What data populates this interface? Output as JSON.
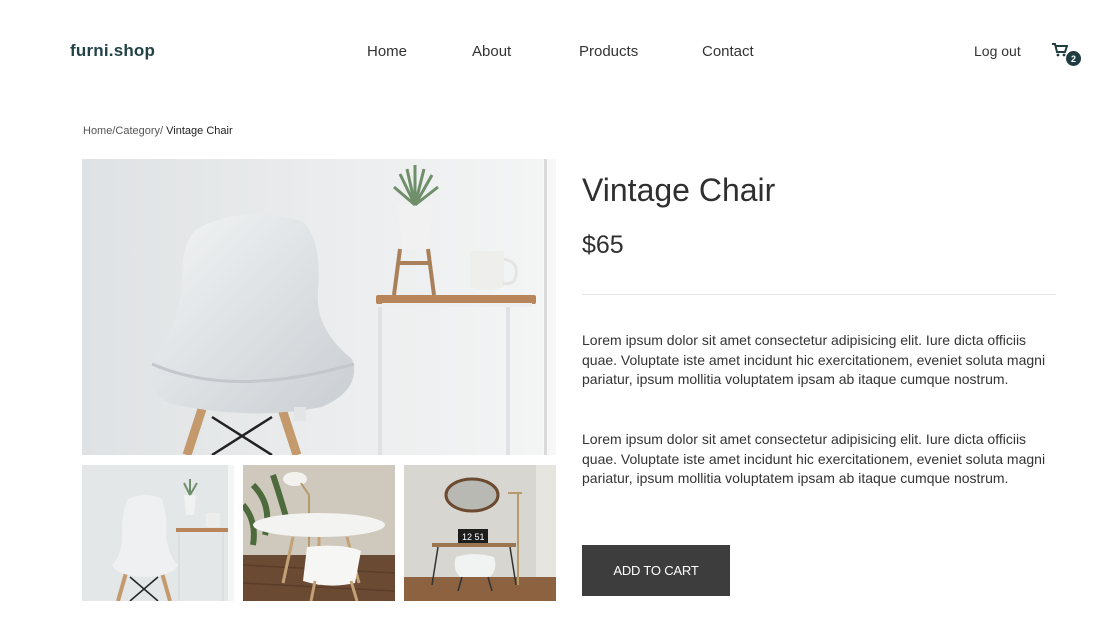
{
  "header": {
    "logo": "furni.shop",
    "nav": [
      "Home",
      "About",
      "Products",
      "Contact"
    ],
    "logout": "Log out",
    "cart_count": "2"
  },
  "breadcrumb": {
    "path": "Home/Category/",
    "current": " Vintage Chair"
  },
  "product": {
    "title": "Vintage Chair",
    "price": "$65",
    "descriptions": [
      "Lorem ipsum dolor sit amet consectetur adipisicing elit. Iure dicta officiis quae. Voluptate iste amet incidunt hic exercitationem, eveniet soluta magni pariatur, ipsum mollitia voluptatem ipsam ab itaque cumque nostrum.",
      "Lorem ipsum dolor sit amet consectetur adipisicing elit. Iure dicta officiis quae. Voluptate iste amet incidunt hic exercitationem, eveniet soluta magni pariatur, ipsum mollitia voluptatem ipsam ab itaque cumque nostrum."
    ],
    "add_to_cart": "ADD TO CART"
  },
  "gallery": {
    "clock_text": "12 51"
  },
  "colors": {
    "brand": "#234246",
    "badge": "#1f3c40",
    "button": "#3d3d3d"
  }
}
